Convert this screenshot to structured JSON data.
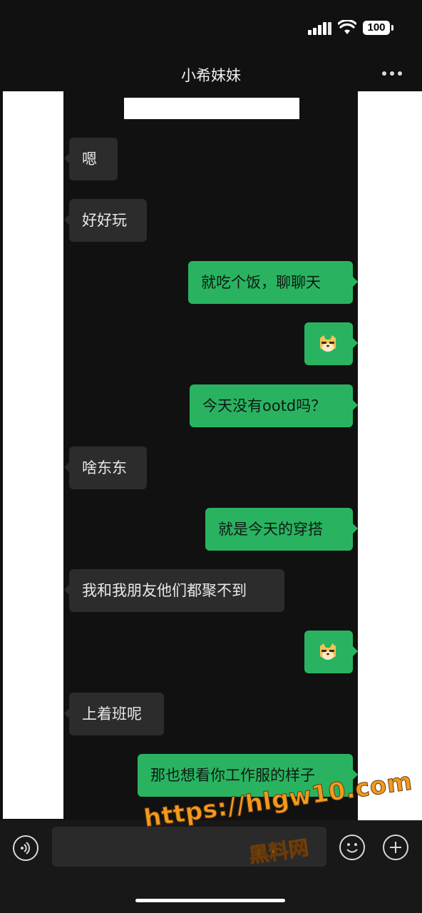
{
  "status_bar": {
    "battery": "100"
  },
  "header": {
    "title": "小希妹妹",
    "more_icon": "more-dots-icon"
  },
  "messages": [
    {
      "side": "in",
      "text": "嗯"
    },
    {
      "side": "in",
      "text": "好好玩"
    },
    {
      "side": "out",
      "text": "就吃个饭，聊聊天"
    },
    {
      "side": "out",
      "emoji": "doge"
    },
    {
      "side": "out",
      "text": "今天没有ootd吗？"
    },
    {
      "side": "in",
      "text": "啥东东"
    },
    {
      "side": "out",
      "text": "就是今天的穿搭"
    },
    {
      "side": "in",
      "text": "我和我朋友他们都聚不到"
    },
    {
      "side": "out",
      "emoji": "doge"
    },
    {
      "side": "in",
      "text": "上着班呢"
    },
    {
      "side": "out",
      "text": "那也想看你工作服的样子"
    }
  ],
  "input_bar": {
    "voice_icon": "voice-icon",
    "emoji_icon": "emoji-icon",
    "plus_icon": "plus-icon"
  },
  "watermark": {
    "url": "https://hlgw10.com",
    "name": "黑料网"
  },
  "colors": {
    "outgoing": "#29b361",
    "incoming": "#2c2c2c",
    "background": "#111111"
  }
}
